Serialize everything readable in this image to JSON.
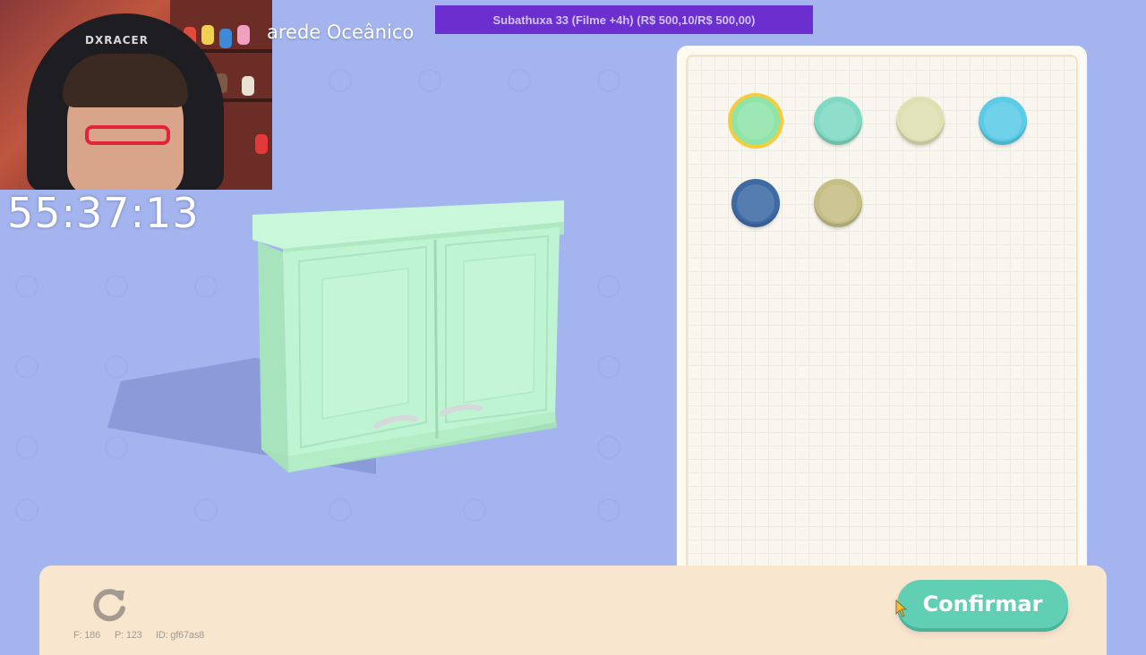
{
  "stream": {
    "timer": "55:37:13",
    "subathon_banner": "Subathuxa 33 (Filme +4h) (R$ 500,10/R$ 500,00)",
    "chair_brand": "DXRACER"
  },
  "game": {
    "item_name": "arede Oceânico",
    "swatches": [
      {
        "color": "#8fe4a9",
        "selected": true
      },
      {
        "color": "#80d9c4",
        "selected": false
      },
      {
        "color": "#dfe1b3",
        "selected": false
      },
      {
        "color": "#5ccbe7",
        "selected": false
      },
      {
        "color": "#3f6ba4",
        "selected": false
      },
      {
        "color": "#c4bf85",
        "selected": false
      }
    ],
    "cabinet_color": "#b8f2cf",
    "confirm_label": "Confirmar",
    "debug": {
      "f": "F: 186",
      "p": "P: 123",
      "id": "ID: gf67as8"
    },
    "icons": {
      "reset": "refresh-icon"
    }
  }
}
